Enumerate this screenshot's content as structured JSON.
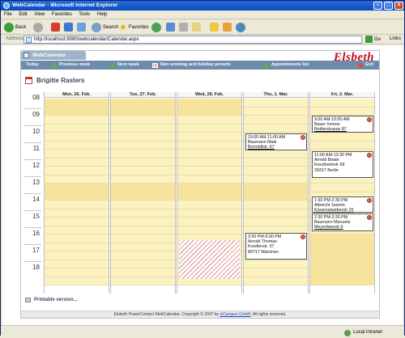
{
  "window": {
    "title": "WebCalendar - Microsoft Internet Explorer"
  },
  "menu": [
    "File",
    "Edit",
    "View",
    "Favorites",
    "Tools",
    "Help"
  ],
  "toolbar": {
    "back": "Back",
    "search": "Search",
    "favorites": "Favorites"
  },
  "address": {
    "label": "Address",
    "url": "http://localhost:8080/webcalendar/Calendar.aspx",
    "go": "Go",
    "links": "Links"
  },
  "app": {
    "tab": "WebCalendar",
    "logo": "Elsbeth",
    "nav": {
      "today": "Today",
      "prev": "Previous week",
      "next": "Next week",
      "legend": "Non working and holiday periods",
      "appointments": "Appointments list",
      "exit": "Exit"
    },
    "person": "Brigitte Rasters",
    "hours": [
      "08",
      "09",
      "10",
      "11",
      "12",
      "13",
      "14",
      "15",
      "16",
      "17",
      "18"
    ],
    "days": [
      "Mon, 26. Feb.",
      "Tue, 27. Feb.",
      "Wed, 28. Feb.",
      "Thu, 1. Mar.",
      "Fri, 2. Mar."
    ],
    "appointments": {
      "thu1": {
        "time": "10:00 AM-11:00 AM",
        "name": "Baumann Maik",
        "street": "Bertoldtstr. 67",
        "city": ""
      },
      "thu2": {
        "time": "3:30 PM-5:00 PM",
        "name": "Arnold Thomas",
        "street": "Krsellerstr. 37",
        "city": "80717 München"
      },
      "fri1": {
        "time": "9:00 AM-10:00 AM",
        "name": "Bauer Ivonne",
        "street": "Reitlerstrasse 87",
        "city": ""
      },
      "fri2": {
        "time": "11:00 AM-12:30 PM",
        "name": "Arnold Beate",
        "street": "Kreutheimstr 68",
        "city": "39317 Berlin"
      },
      "fri3": {
        "time": "1:30 PM-2:30 PM",
        "name": "Albrecht Jasmin",
        "street": "Kürzenstweberstr 25",
        "city": ""
      },
      "fri4": {
        "time": "2:30 PM-3:30 PM",
        "name": "Baumann Manuela",
        "street": "Meyerbeerstr 6",
        "city": ""
      }
    },
    "print": "Printable version...",
    "footer": "Elsbeth PowerContact WebCalendar. Copyright © 2007 by",
    "footer_company": "isCampus GmbH",
    "footer_end": ". All rights reserved."
  },
  "status": {
    "zone": "Local intranet"
  }
}
